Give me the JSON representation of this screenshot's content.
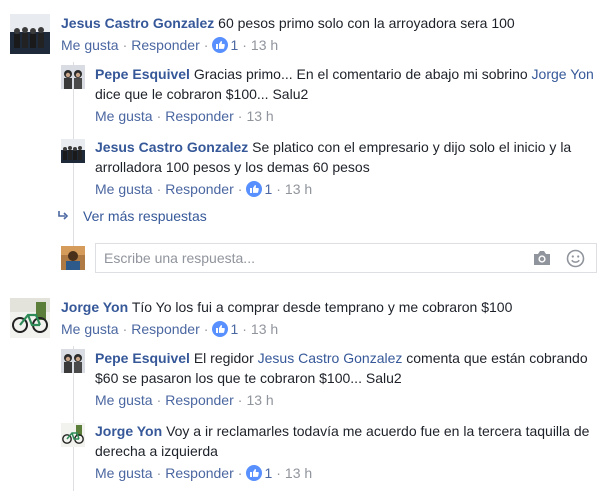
{
  "comments": [
    {
      "author": "Jesus Castro Gonzalez",
      "text": "60 pesos primo solo con la arroyadora sera 100",
      "like": "Me gusta",
      "reply": "Responder",
      "likes": "1",
      "time": "13 h",
      "avatar_icon": "group-photo-avatar"
    },
    {
      "author": "Pepe Esquivel",
      "text_before": "Gracias primo... En el comentario de abajo mi sobrino ",
      "mention": "Jorge Yon",
      "text_after": " dice que le cobraron $100... Salu2",
      "like": "Me gusta",
      "reply": "Responder",
      "time": "13 h",
      "avatar_icon": "two-people-avatar"
    },
    {
      "author": "Jesus Castro Gonzalez",
      "text": "Se platico con el empresario y dijo solo el inicio y la arrolladora 100 pesos y los demas 60 pesos",
      "like": "Me gusta",
      "reply": "Responder",
      "likes": "1",
      "time": "13 h",
      "avatar_icon": "group-photo-avatar"
    },
    {
      "author": "Jorge Yon",
      "text": "Tío Yo los fui a comprar desde temprano y me cobraron $100",
      "like": "Me gusta",
      "reply": "Responder",
      "likes": "1",
      "time": "13 h",
      "avatar_icon": "bicycle-avatar"
    },
    {
      "author": "Pepe Esquivel",
      "text_before": "El regidor ",
      "mention": "Jesus Castro Gonzalez",
      "text_after": " comenta que están cobrando $60 se pasaron los que te cobraron $100... Salu2",
      "like": "Me gusta",
      "reply": "Responder",
      "time": "13 h",
      "avatar_icon": "two-people-avatar"
    },
    {
      "author": "Jorge Yon",
      "text": "Voy a ir reclamarles todavía me acuerdo fue en la tercera taquilla de derecha a izquierda",
      "like": "Me gusta",
      "reply": "Responder",
      "likes": "1",
      "time": "13 h",
      "avatar_icon": "bicycle-avatar"
    }
  ],
  "more_replies": "Ver más respuestas",
  "reply_input": {
    "placeholder": "Escribe una respuesta...",
    "camera_icon": "camera-icon",
    "emoji_icon": "emoji-icon"
  },
  "colors": {
    "link": "#365899",
    "meta": "#90949c",
    "like_badge": "#5890ff",
    "border": "#dddfe2"
  }
}
